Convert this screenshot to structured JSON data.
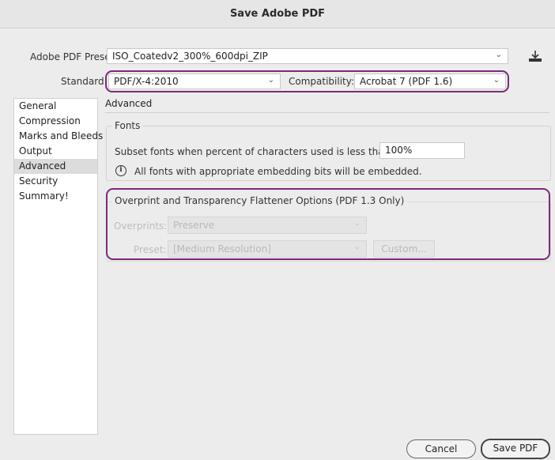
{
  "window": {
    "title": "Save Adobe PDF"
  },
  "preset": {
    "label": "Adobe PDF Preset:",
    "value": "ISO_Coatedv2_300%_600dpi_ZIP"
  },
  "standard": {
    "label": "Standard:",
    "value": "PDF/X-4:2010"
  },
  "compatibility": {
    "label": "Compatibility:",
    "value": "Acrobat 7 (PDF 1.6)"
  },
  "sidebar": {
    "items": [
      {
        "label": "General"
      },
      {
        "label": "Compression"
      },
      {
        "label": "Marks and Bleeds"
      },
      {
        "label": "Output"
      },
      {
        "label": "Advanced"
      },
      {
        "label": "Security"
      },
      {
        "label": "Summary!"
      }
    ],
    "selected": "Advanced"
  },
  "panel": {
    "title": "Advanced"
  },
  "fonts": {
    "legend": "Fonts",
    "subset_label": "Subset fonts when percent of characters used is less than:",
    "subset_value": "100%",
    "info_text": "All fonts with appropriate embedding bits will be embedded."
  },
  "overprint": {
    "legend": "Overprint and Transparency Flattener Options (PDF 1.3 Only)",
    "overprints_label": "Overprints:",
    "overprints_value": "Preserve",
    "preset_label": "Preset:",
    "preset_value": "[Medium Resolution]",
    "custom_label": "Custom..."
  },
  "buttons": {
    "cancel": "Cancel",
    "save": "Save PDF"
  },
  "colors": {
    "highlight": "#7b2a7b"
  }
}
